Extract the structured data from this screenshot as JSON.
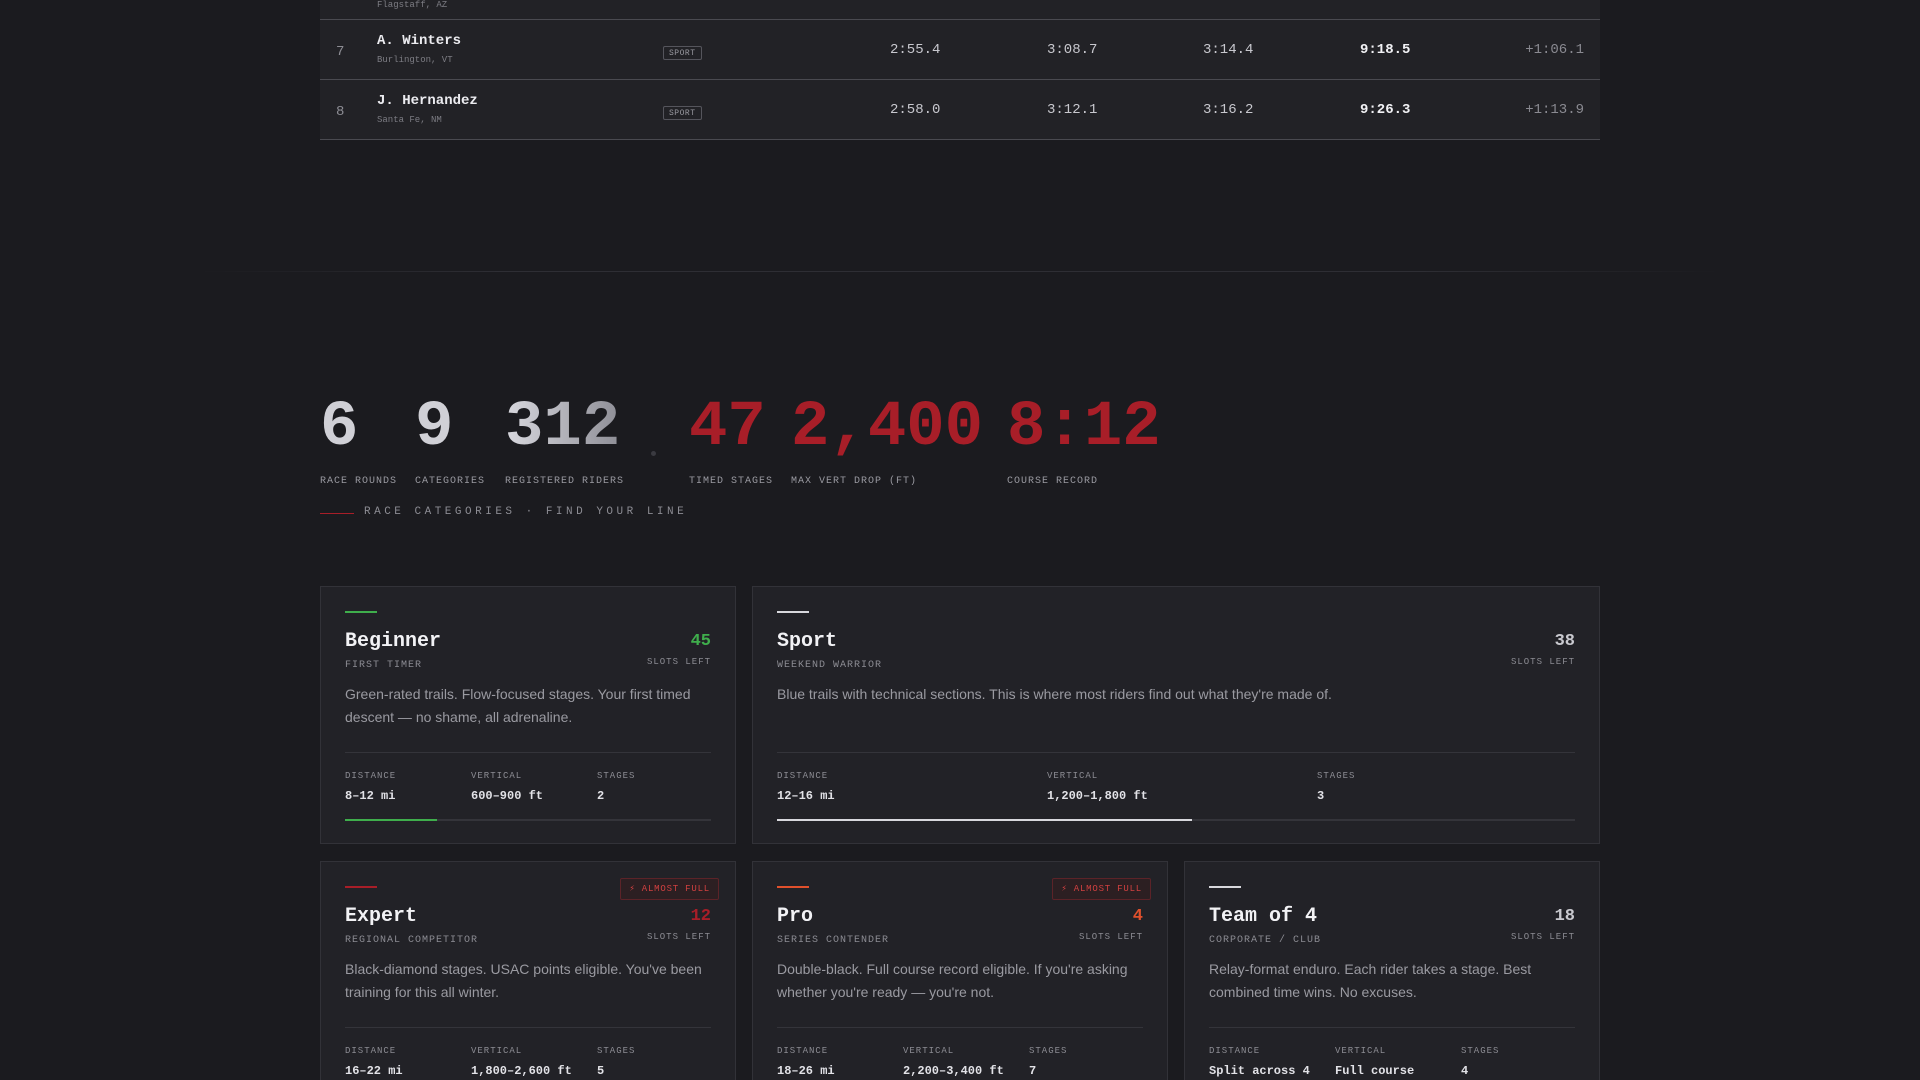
{
  "results": {
    "rows": [
      {
        "rank": "",
        "name": "",
        "location": "Flagstaff, AZ",
        "category": "",
        "s1": "",
        "s2": "",
        "s3": "",
        "total": "",
        "gap": ""
      },
      {
        "rank": "7",
        "name": "A. Winters",
        "location": "Burlington, VT",
        "category": "SPORT",
        "s1": "2:55.4",
        "s2": "3:08.7",
        "s3": "3:14.4",
        "total": "9:18.5",
        "gap": "+1:06.1"
      },
      {
        "rank": "8",
        "name": "J. Hernandez",
        "location": "Santa Fe, NM",
        "category": "SPORT",
        "s1": "2:58.0",
        "s2": "3:12.1",
        "s3": "3:16.2",
        "total": "9:26.3",
        "gap": "+1:13.9"
      }
    ]
  },
  "stats": [
    {
      "value": "6",
      "label": "RACE ROUNDS"
    },
    {
      "value": "9",
      "label": "CATEGORIES"
    },
    {
      "value": "312",
      "label": "REGISTERED RIDERS"
    },
    {
      "value": "47",
      "label": "TIMED STAGES"
    },
    {
      "value": "2,400",
      "label": "MAX VERT DROP (FT)"
    },
    {
      "value": "8:12",
      "label": "COURSE RECORD"
    }
  ],
  "section_label": "RACE CATEGORIES · FIND YOUR LINE",
  "meta_labels": {
    "distance": "DISTANCE",
    "vertical": "VERTICAL",
    "stages": "STAGES"
  },
  "slots_label": "SLOTS LEFT",
  "almost_full_label": "⚡ ALMOST FULL",
  "categories": [
    {
      "name": "Beginner",
      "subtitle": "FIRST TIMER",
      "slots": "45",
      "description": "Green-rated trails. Flow-focused stages. Your first timed descent — no shame, all adrenaline.",
      "distance": "8–12 mi",
      "vertical": "600–900 ft",
      "stages": "2",
      "accent": "#3fae4c",
      "slots_color": "#3fae4c",
      "fill_pct": 25
    },
    {
      "name": "Sport",
      "subtitle": "WEEKEND WARRIOR",
      "slots": "38",
      "description": "Blue trails with technical sections. This is where most riders find out what they're made of.",
      "distance": "12–16 mi",
      "vertical": "1,200–1,800 ft",
      "stages": "3",
      "accent": "#d8d8dd",
      "slots_color": "#c9c9cf",
      "fill_pct": 52
    },
    {
      "name": "Expert",
      "subtitle": "REGIONAL COMPETITOR",
      "slots": "12",
      "description": "Black-diamond stages. USAC points eligible. You've been training for this all winter.",
      "distance": "16–22 mi",
      "vertical": "1,800–2,600 ft",
      "stages": "5",
      "accent": "#a81e28",
      "slots_color": "#a81e28"
    },
    {
      "name": "Pro",
      "subtitle": "SERIES CONTENDER",
      "slots": "4",
      "description": "Double-black. Full course record eligible. If you're asking whether you're ready — you're not.",
      "distance": "18–26 mi",
      "vertical": "2,200–3,400 ft",
      "stages": "7",
      "accent": "#e0502c",
      "slots_color": "#e0502c"
    },
    {
      "name": "Team of 4",
      "subtitle": "CORPORATE / CLUB",
      "slots": "18",
      "description": "Relay-format enduro. Each rider takes a stage. Best combined time wins. No excuses.",
      "distance": "Split across 4",
      "vertical": "Full course",
      "stages": "4",
      "accent": "#d8d8dd",
      "slots_color": "#c9c9cf"
    }
  ]
}
